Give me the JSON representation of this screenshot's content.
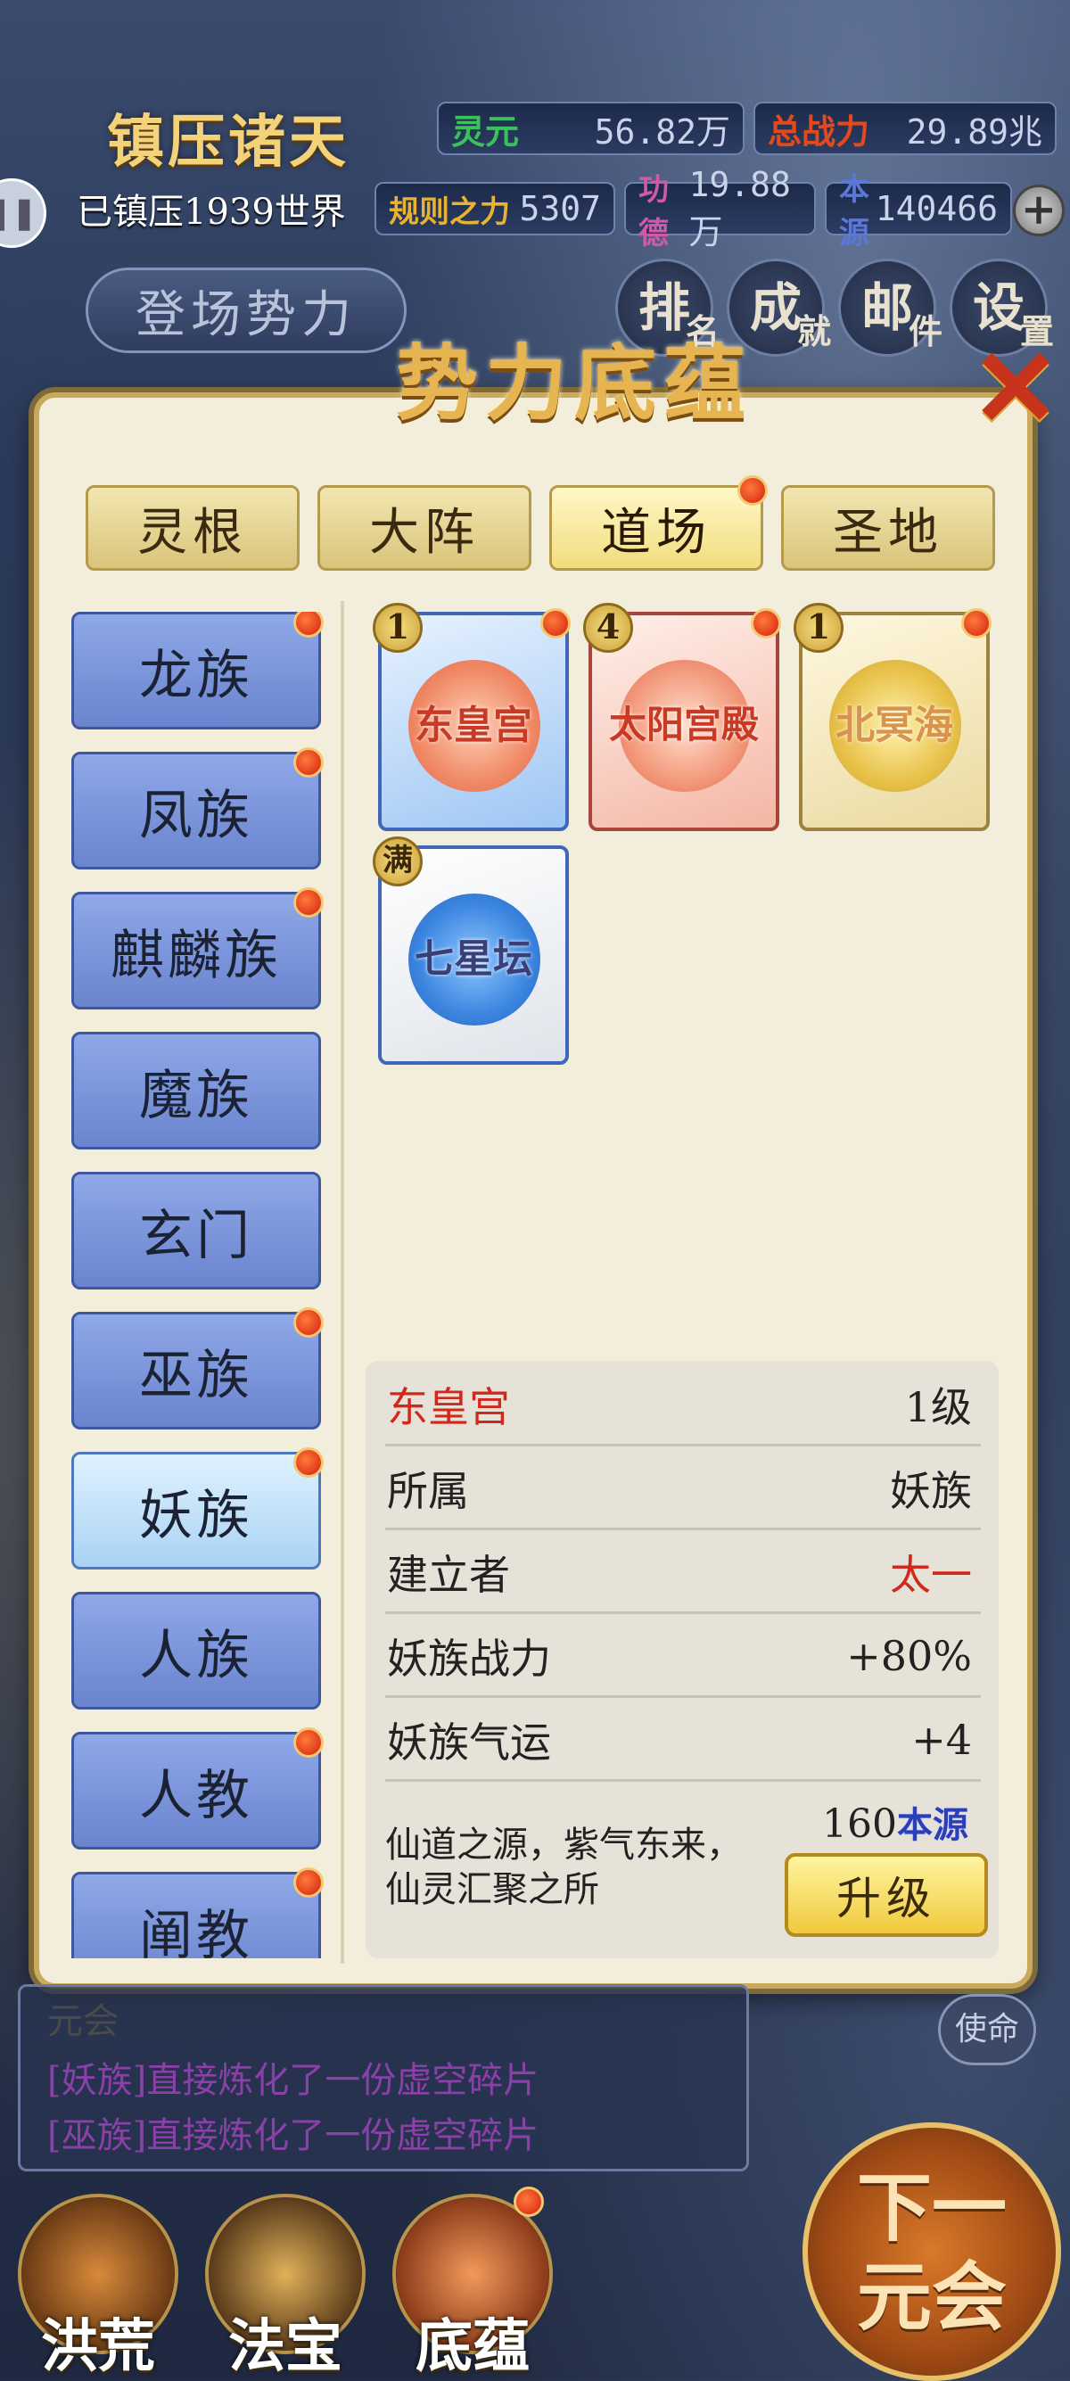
{
  "hud": {
    "title": "镇压诸天",
    "lingyuan_label": "灵元",
    "lingyuan_value": "56.82万",
    "power_label": "总战力",
    "power_value": "29.89兆",
    "suppressed_text": "已镇压1939世界",
    "rules_label": "规则之力",
    "rules_value": "5307",
    "merit_label": "功德",
    "merit_value": "19.88万",
    "origin_label": "本源",
    "origin_value": "140466",
    "stage_button": "登场势力",
    "pause_icon": "pause-icon",
    "plus_icon": "plus-icon",
    "icons": [
      {
        "main": "排",
        "sub": "名"
      },
      {
        "main": "成",
        "sub": "就"
      },
      {
        "main": "邮",
        "sub": "件"
      },
      {
        "main": "设",
        "sub": "置"
      }
    ]
  },
  "modal": {
    "title": "势力底蕴",
    "close_icon": "close-icon",
    "tabs": [
      {
        "label": "灵根",
        "active": false,
        "dot": false
      },
      {
        "label": "大阵",
        "active": false,
        "dot": false
      },
      {
        "label": "道场",
        "active": true,
        "dot": true
      },
      {
        "label": "圣地",
        "active": false,
        "dot": false
      }
    ],
    "factions": [
      {
        "label": "龙族",
        "dot": true
      },
      {
        "label": "凤族",
        "dot": true
      },
      {
        "label": "麒麟族",
        "dot": true
      },
      {
        "label": "魔族",
        "dot": false
      },
      {
        "label": "玄门",
        "dot": false
      },
      {
        "label": "巫族",
        "dot": true
      },
      {
        "label": "妖族",
        "dot": true,
        "active": true
      },
      {
        "label": "人族",
        "dot": false
      },
      {
        "label": "人教",
        "dot": true
      },
      {
        "label": "阐教",
        "dot": true
      }
    ],
    "cards": [
      {
        "name": "东皇宫",
        "level": "1",
        "dot": true,
        "theme": "blue-red"
      },
      {
        "name": "太阳宫殿",
        "level": "4",
        "dot": true,
        "theme": "red"
      },
      {
        "name": "北冥海",
        "level": "1",
        "dot": true,
        "theme": "gold"
      },
      {
        "name": "七星坛",
        "level": "满",
        "dot": false,
        "theme": "blue"
      }
    ],
    "info": {
      "name": "东皇宫",
      "level": "1级",
      "rows": [
        {
          "key": "所属",
          "value": "妖族"
        },
        {
          "key": "建立者",
          "value": "太一"
        },
        {
          "key": "妖族战力",
          "value": "+80%"
        },
        {
          "key": "妖族气运",
          "value": "+4"
        }
      ],
      "description": "仙道之源，紫气东来，仙灵汇聚之所",
      "cost_amount": "160",
      "cost_unit": "本源",
      "upgrade_label": "升级"
    }
  },
  "log": {
    "header": "元会",
    "lines": [
      "[妖族]直接炼化了一份虚空碎片",
      "[巫族]直接炼化了一份虚空碎片"
    ],
    "mission_label": "使命"
  },
  "bottom_nav": {
    "items": [
      {
        "label": "洪荒",
        "dot": false
      },
      {
        "label": "法宝",
        "dot": false
      },
      {
        "label": "底蕴",
        "dot": true
      }
    ],
    "next_label_1": "下一",
    "next_label_2": "元会"
  },
  "colors": {
    "accent_gold": "#e6b552",
    "red_text": "#d0281c",
    "log_purple": "#8b3fa8"
  }
}
